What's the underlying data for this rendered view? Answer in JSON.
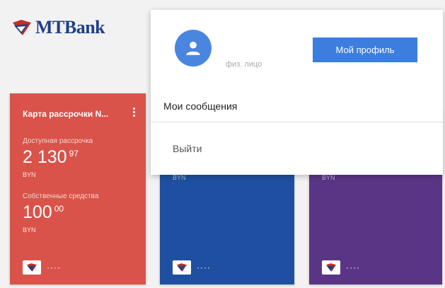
{
  "logo": {
    "text": "MTBank"
  },
  "cards": [
    {
      "title": "Карта рассрочки N...",
      "installment_label": "Доступная рассрочка",
      "installment_int": "2 130",
      "installment_dec": "97",
      "installment_cur": "BYN",
      "own_label": "Собственные средства",
      "own_int": "100",
      "own_dec": "00",
      "own_cur": "BYN",
      "masked": "····",
      "color": "#d9534a"
    },
    {
      "cur": "BYN",
      "masked": "····",
      "color": "#1f4fa0"
    },
    {
      "cur": "BYN",
      "masked": "····",
      "color": "#5b3585"
    }
  ],
  "dropdown": {
    "user_type": "физ. лицо",
    "profile_button": "Мой профиль",
    "messages": "Мои сообщения",
    "logout": "Выйти"
  },
  "colors": {
    "accent": "#3b7ede",
    "avatar": "#4a86e0"
  },
  "icons": {
    "avatar": "person-icon",
    "menu": "more-vertical-icon",
    "card_logo": "mtbank-logo-icon"
  }
}
